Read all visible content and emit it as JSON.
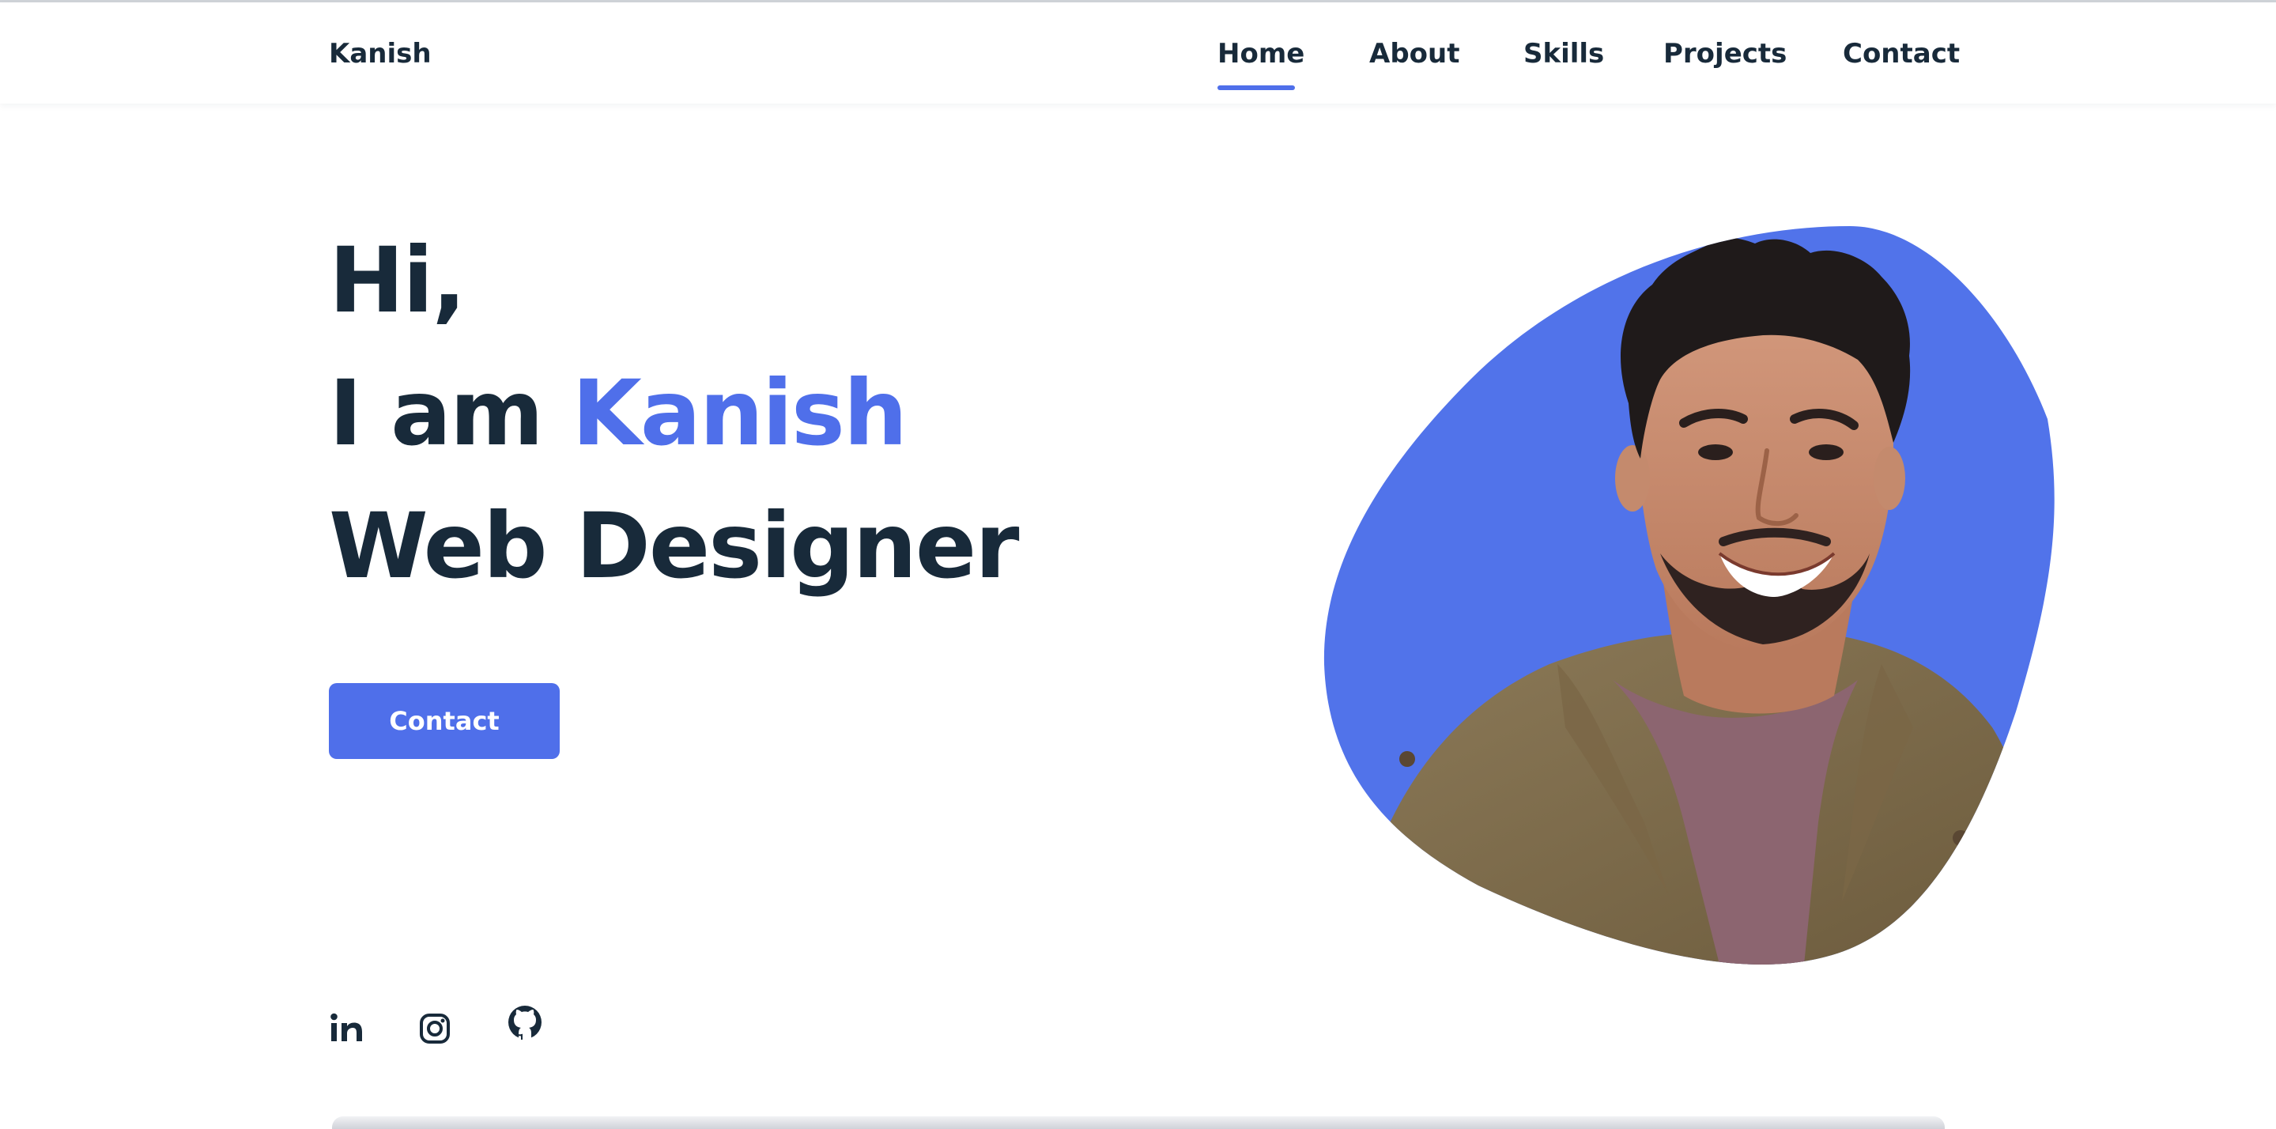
{
  "header": {
    "logo": "Kanish",
    "nav": [
      {
        "label": "Home",
        "active": true
      },
      {
        "label": "About",
        "active": false
      },
      {
        "label": "Skills",
        "active": false
      },
      {
        "label": "Projects",
        "active": false
      },
      {
        "label": "Contact",
        "active": false
      }
    ]
  },
  "hero": {
    "line1": "Hi,",
    "line2_prefix": "I am ",
    "line2_name": "Kanish",
    "line3": "Web Designer",
    "button_label": "Contact",
    "image_description_icon": "profile-photo-blob"
  },
  "social": [
    {
      "icon": "linkedin-icon"
    },
    {
      "icon": "instagram-icon"
    },
    {
      "icon": "github-icon"
    }
  ],
  "colors": {
    "accent": "#4f6fea",
    "text": "#182a3a",
    "background": "#ffffff"
  }
}
